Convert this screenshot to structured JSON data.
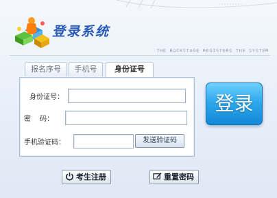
{
  "brand": {
    "title": "登录系统",
    "subtitle": "THE BACKSTAGE REGISTERS THE SYSTEM"
  },
  "tabs": [
    {
      "label": "报名序号",
      "active": false
    },
    {
      "label": "手机号",
      "active": false
    },
    {
      "label": "身份证号",
      "active": true
    }
  ],
  "form": {
    "id_label": "身份证号：",
    "id_value": "",
    "password_label": "密　 码：",
    "password_value": "",
    "code_label": "手机验证码：",
    "code_value": "",
    "send_code_label": "发送验证码"
  },
  "login_button": "登录",
  "footer_buttons": {
    "register": "考生注册",
    "reset": "重置密码"
  },
  "colors": {
    "accent": "#2a5ab8",
    "login": "#2ea8ec"
  },
  "icons": {
    "logo": "people-cubes-icon",
    "register": "power-icon",
    "reset": "pencil-icon"
  }
}
